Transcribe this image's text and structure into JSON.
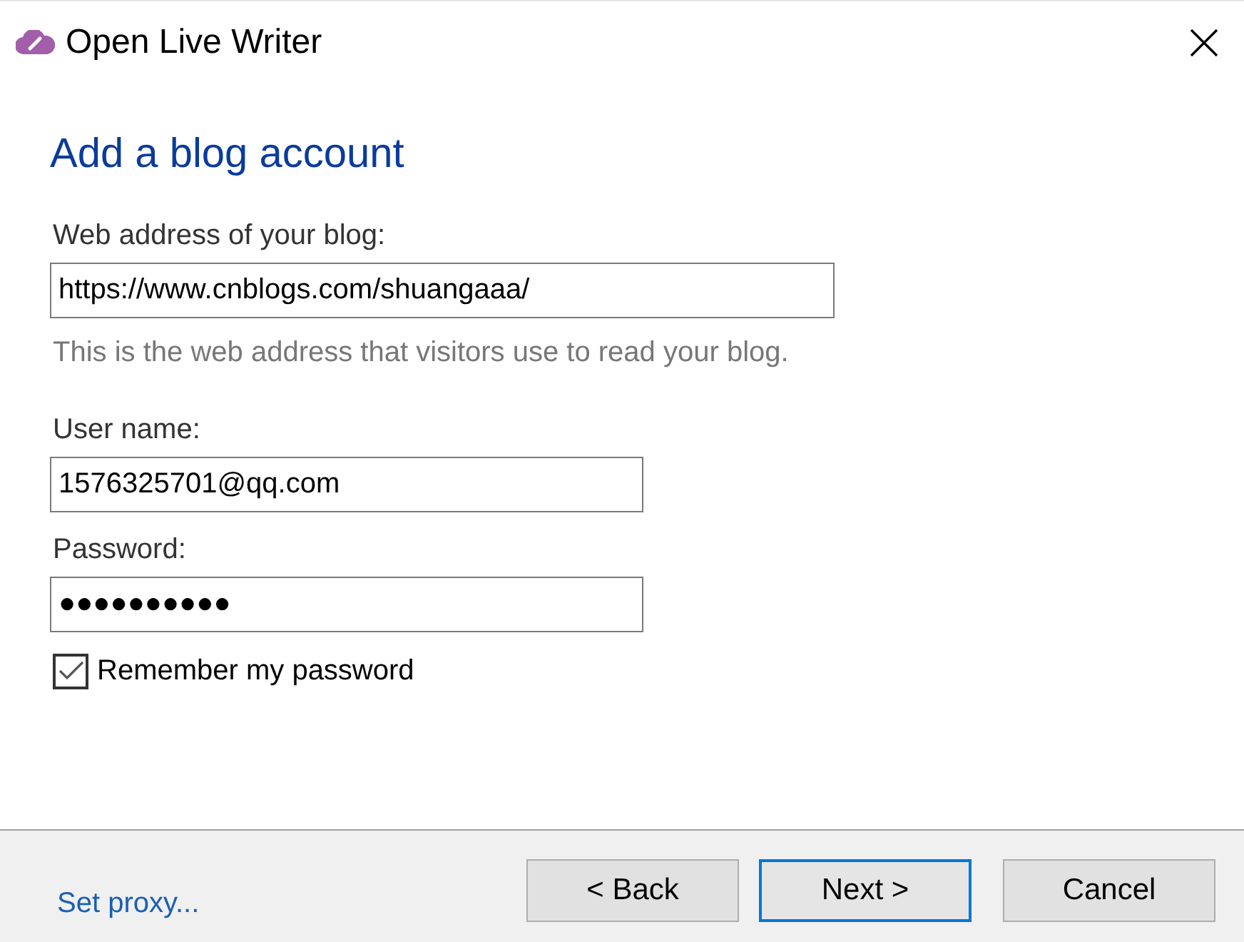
{
  "window": {
    "title": "Open Live Writer"
  },
  "heading": "Add a blog account",
  "fields": [
    {
      "label": "Web address of your blog:",
      "value": "https://www.cnblogs.com/shuangaaa/",
      "hint": "This is the web address that visitors use to read your blog."
    },
    {
      "label": "User name:",
      "value": "1576325701@qq.com"
    },
    {
      "label": "Password:",
      "value": "●●●●●●●●●●"
    }
  ],
  "remember": {
    "label": "Remember my password",
    "checked": true
  },
  "footer": {
    "link": "Set proxy...",
    "buttons": [
      {
        "label": "< Back",
        "selected": false
      },
      {
        "label": "Next >",
        "selected": true
      },
      {
        "label": "Cancel",
        "selected": false
      }
    ]
  }
}
